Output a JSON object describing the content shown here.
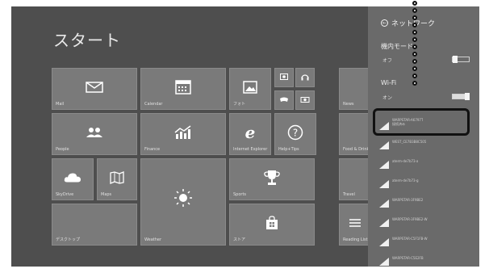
{
  "start": {
    "title": "スタート"
  },
  "tiles": {
    "mail": "Mail",
    "calendar": "Calendar",
    "photos": "フォト",
    "news": "News",
    "people": "People",
    "finance": "Finance",
    "ie": "Internet Explorer",
    "help": "Help+Tips",
    "food": "Food & Drink",
    "skydrive": "SkyDrive",
    "maps": "Maps",
    "sports": "Sports",
    "travel": "Travel",
    "desktop": "デスクトップ",
    "weather": "Weather",
    "store": "ストア",
    "reading": "Reading List"
  },
  "panel": {
    "back_label": "ネットワーク",
    "airplane_label": "機内モード",
    "airplane_state": "オフ",
    "wifi_label": "Wi-Fi",
    "wifi_state": "オン",
    "networks": [
      {
        "name": "WARPSTAR-A6797T",
        "sub": "接続済み"
      },
      {
        "name": "WEST_CE7B3B8C505"
      },
      {
        "name": "aterm-de7b73-a"
      },
      {
        "name": "aterm-de7b73-g"
      },
      {
        "name": "WARPSTAR-3F9BE2"
      },
      {
        "name": "WARPSTAR-3F9BE2-W"
      },
      {
        "name": "WARPSTAR-C5F1FB-W"
      },
      {
        "name": "WARPSTAR-C5E2FB"
      }
    ]
  },
  "colors": {
    "background": "#4e4e4e",
    "tile": "#7a7a7a",
    "panel": "#6a6a6a",
    "annotation": "#111111"
  }
}
